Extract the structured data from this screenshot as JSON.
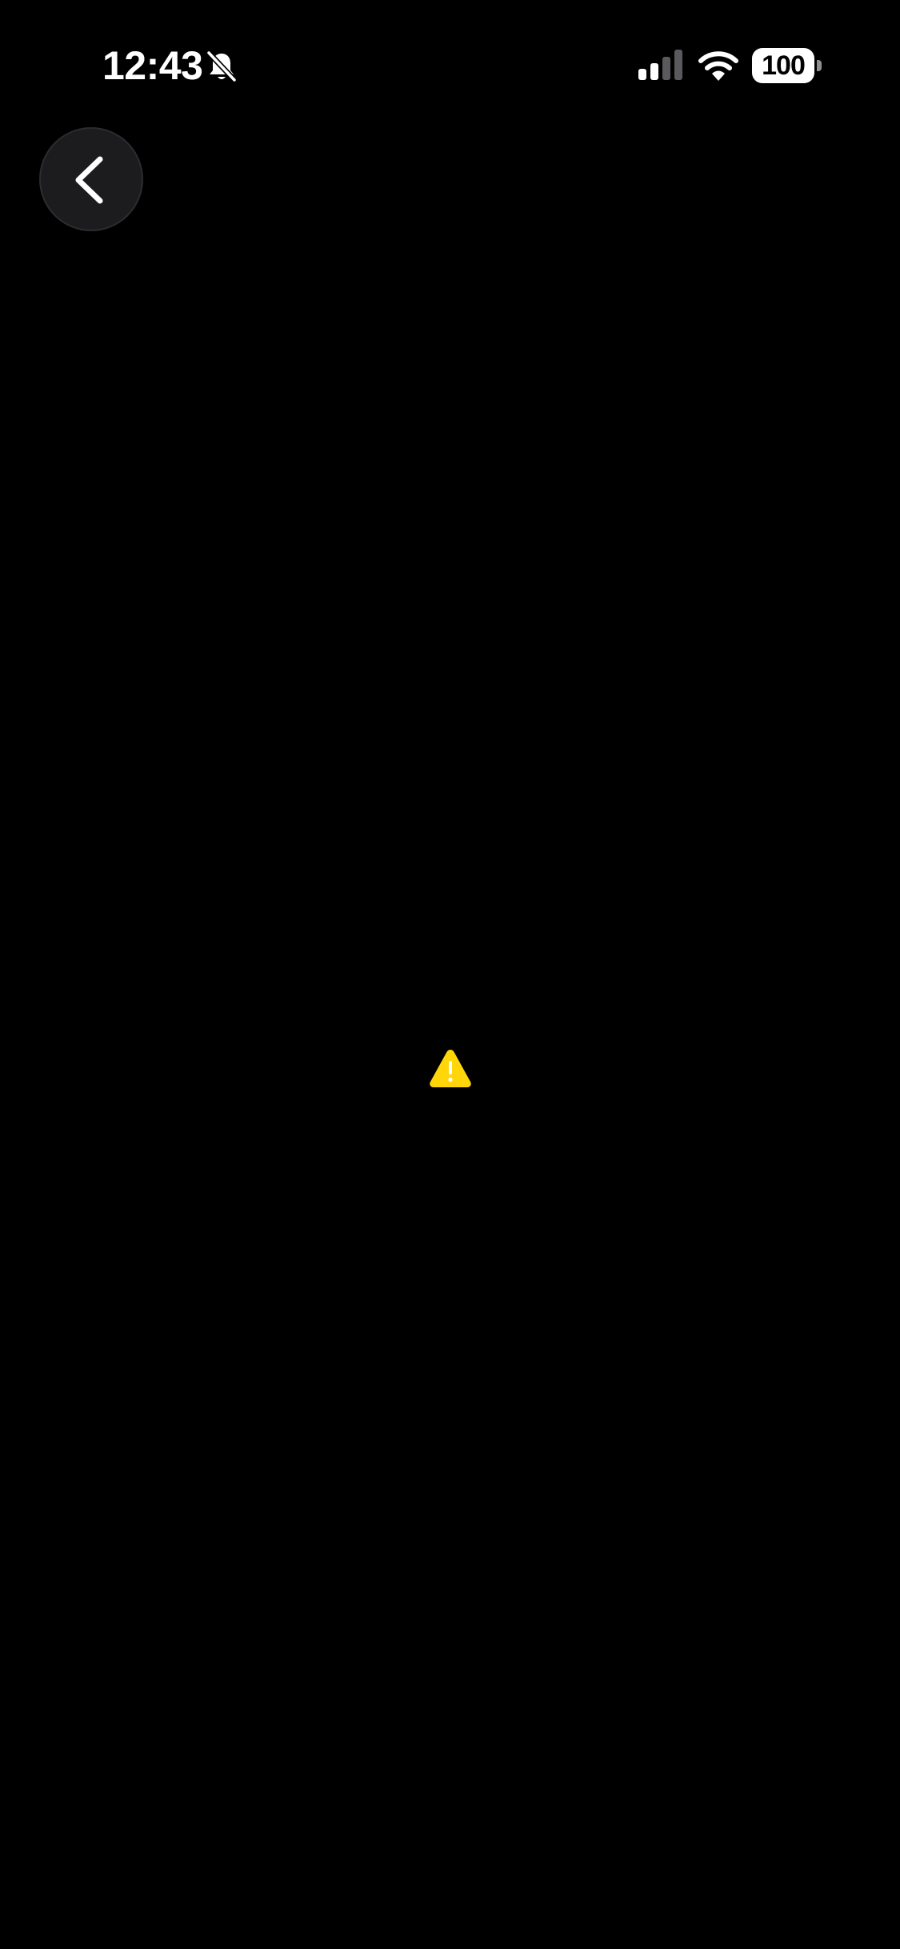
{
  "status_bar": {
    "time": "12:43",
    "silent_icon": "bell-slash-icon",
    "signal_icon": "cellular-signal-icon",
    "wifi_icon": "wifi-icon",
    "battery_level": "100"
  },
  "navigation": {
    "back_icon": "chevron-left-icon"
  },
  "content": {
    "warning_icon": "warning-triangle-icon",
    "warning_color": "#FFD60A"
  },
  "colors": {
    "background": "#000000",
    "back_button_bg": "#1C1C1E"
  }
}
